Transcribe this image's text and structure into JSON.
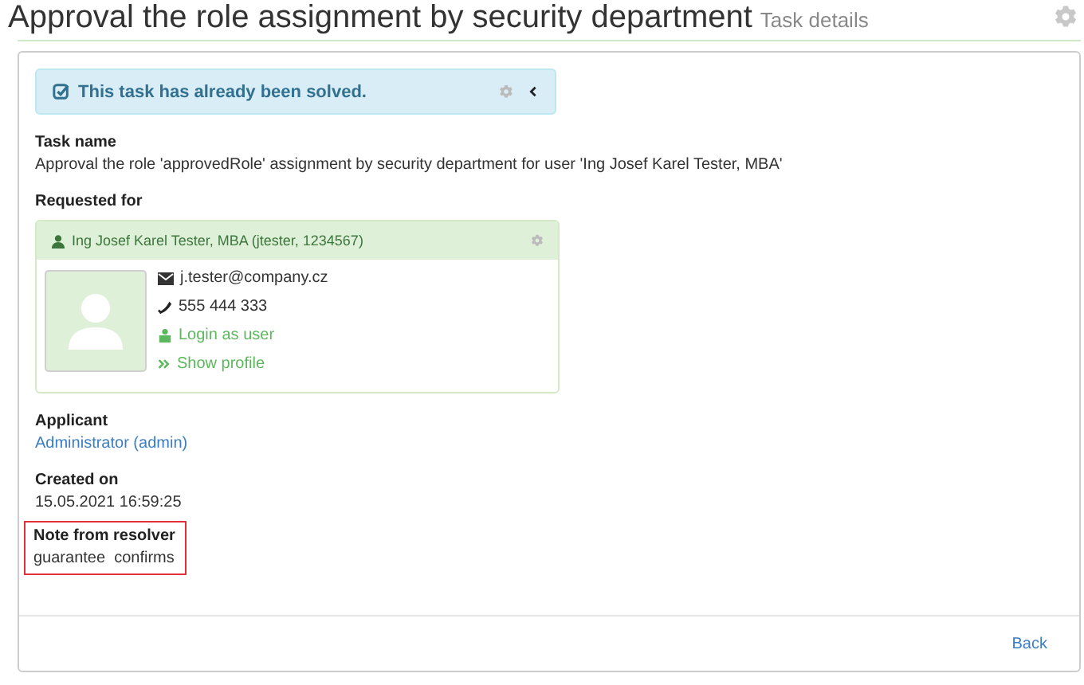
{
  "header": {
    "title": "Approval the role assignment by security department",
    "subtitle": "Task details"
  },
  "alert": {
    "text": "This task has already been solved."
  },
  "fields": [
    {
      "kind": "text",
      "label": "Task name",
      "value": "Approval the role 'approvedRole' assignment by security department for user 'Ing Josef Karel Tester, MBA'",
      "highlighted": false
    },
    {
      "kind": "identity",
      "label": "Requested for",
      "identity": {
        "name": "Ing Josef Karel Tester, MBA (jtester, 1234567)",
        "email": "j.tester@company.cz",
        "phone": "555 444 333",
        "links": [
          "Login as user",
          "Show profile"
        ]
      },
      "highlighted": false
    },
    {
      "kind": "link",
      "label": "Applicant",
      "value": "Administrator (admin)",
      "highlighted": false
    },
    {
      "kind": "text",
      "label": "Created on",
      "value": "15.05.2021 16:59:25",
      "highlighted": false
    },
    {
      "kind": "text",
      "label": "Note from resolver",
      "value": "guarantee  confirms",
      "highlighted": true
    }
  ],
  "footer": {
    "back": "Back"
  }
}
